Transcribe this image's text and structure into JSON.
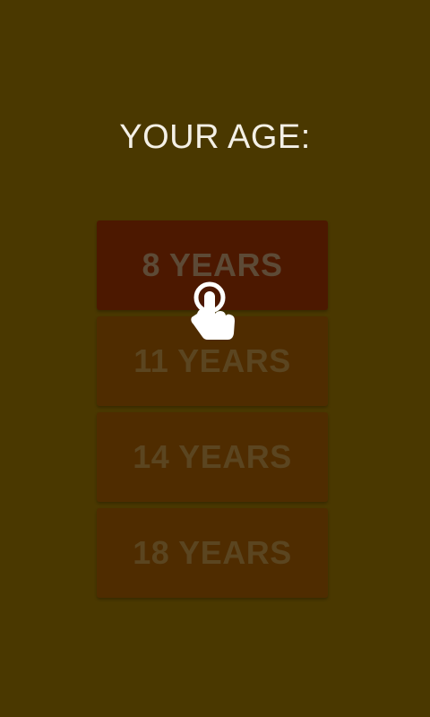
{
  "screen": {
    "title": "YOUR AGE:"
  },
  "age_options": [
    {
      "label": "8 YEARS",
      "selected": true
    },
    {
      "label": "11 YEARS",
      "selected": false
    },
    {
      "label": "14 YEARS",
      "selected": false
    },
    {
      "label": "18 YEARS",
      "selected": false
    }
  ],
  "colors": {
    "background": "#4a3800",
    "option": "#4f2c00",
    "option_selected": "#4c1800",
    "title_text": "#f4f0e6"
  },
  "icons": {
    "tap_hint": "tap-hand-icon"
  }
}
